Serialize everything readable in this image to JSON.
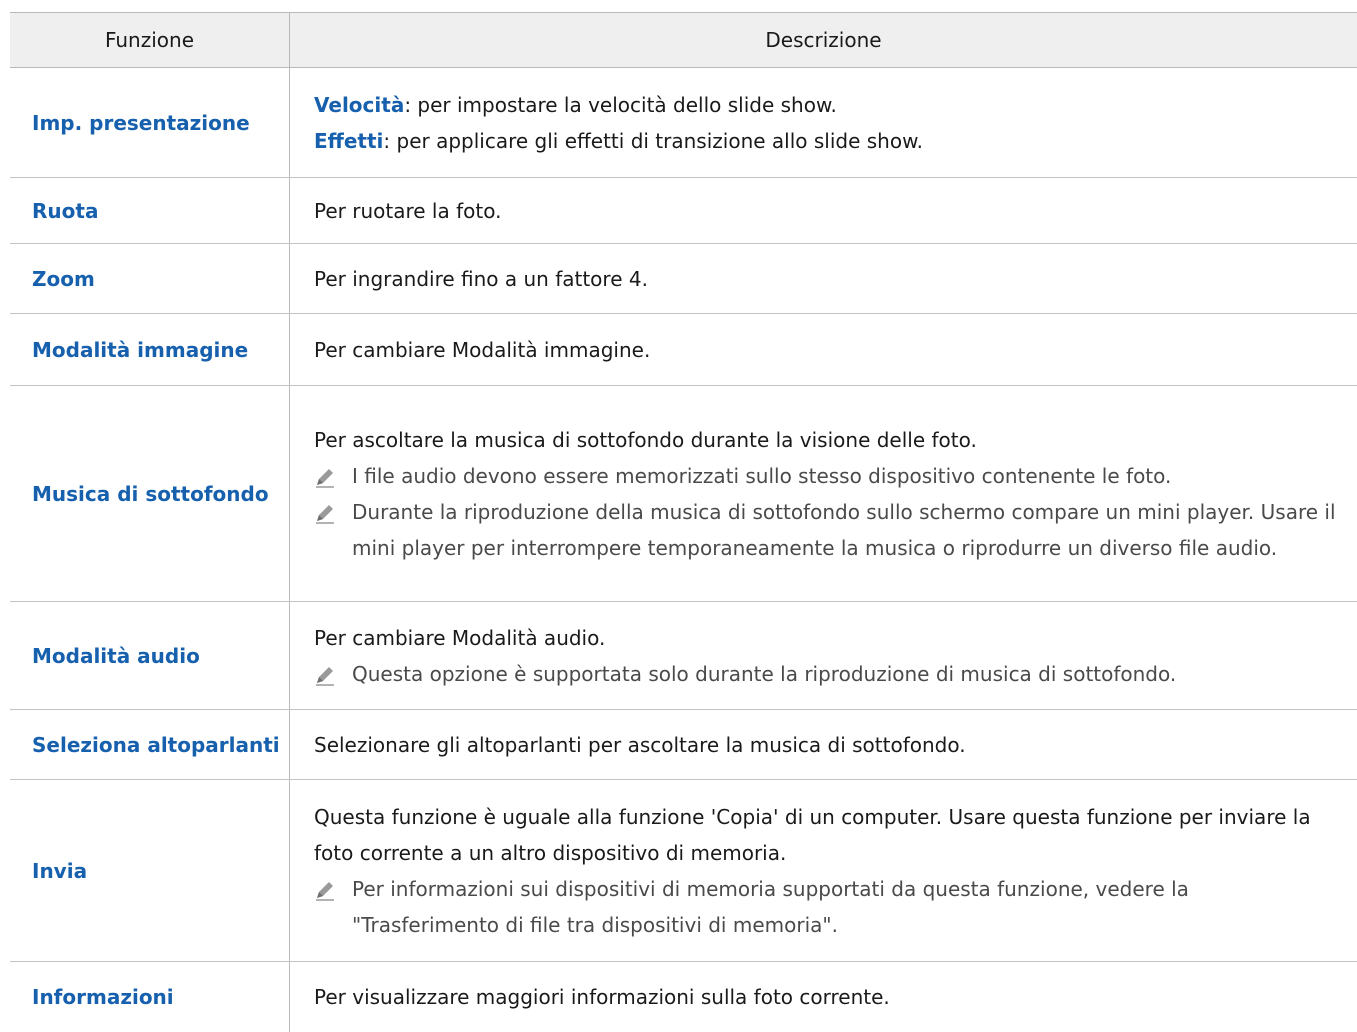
{
  "header": {
    "col1": "Funzione",
    "col2": "Descrizione"
  },
  "rows": [
    {
      "name": "Imp. presentazione",
      "lines": [
        {
          "term": "Velocità",
          "text": ": per impostare la velocità dello slide show."
        },
        {
          "term": "Effetti",
          "text": ": per applicare gli effetti di transizione allo slide show."
        }
      ]
    },
    {
      "name": "Ruota",
      "desc": "Per ruotare la foto."
    },
    {
      "name": "Zoom",
      "desc": "Per ingrandire fino a un fattore 4."
    },
    {
      "name": "Modalità immagine",
      "desc": "Per cambiare Modalità immagine."
    },
    {
      "name": "Musica di sottofondo",
      "desc": "Per ascoltare la musica di sottofondo durante la visione delle foto.",
      "notes": [
        "I file audio devono essere memorizzati sullo stesso dispositivo contenente le foto.",
        "Durante la riproduzione della musica di sottofondo sullo schermo compare un mini player. Usare il mini player per interrompere temporaneamente la musica o riprodurre un diverso file audio."
      ]
    },
    {
      "name": "Modalità audio",
      "desc": "Per cambiare Modalità audio.",
      "notes": [
        "Questa opzione è supportata solo durante la riproduzione di musica di sottofondo."
      ]
    },
    {
      "name": "Seleziona altoparlanti",
      "desc": "Selezionare gli altoparlanti per ascoltare la musica di sottofondo."
    },
    {
      "name": "Invia",
      "desc": "Questa funzione è uguale alla funzione 'Copia' di un computer. Usare questa funzione per inviare la foto corrente a un altro dispositivo di memoria.",
      "notes": [
        "Per informazioni sui dispositivi di memoria supportati da questa funzione, vedere la \"Trasferimento di file tra dispositivi di memoria\"."
      ]
    },
    {
      "name": "Informazioni",
      "desc": "Per visualizzare maggiori informazioni sulla foto corrente."
    }
  ],
  "icons": {
    "note": "pencil-note-icon"
  },
  "colors": {
    "accent": "#1660ae",
    "header_bg": "#efefef",
    "border": "#b9b9b9"
  }
}
